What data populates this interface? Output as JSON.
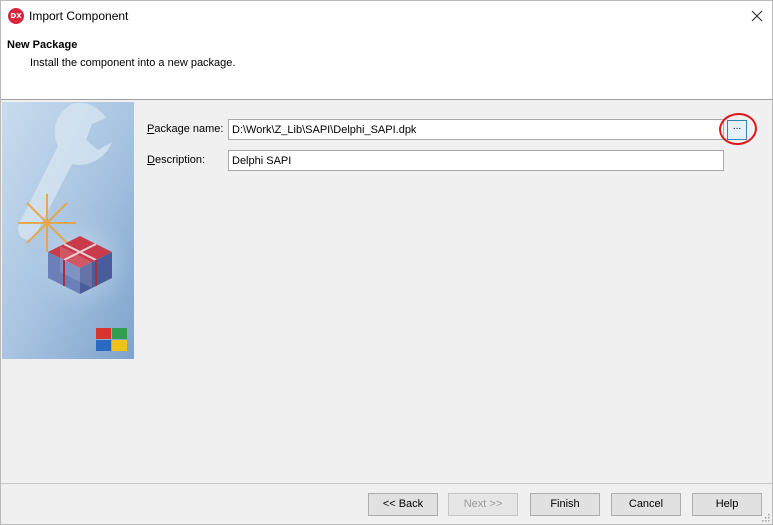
{
  "window": {
    "title": "Import Component",
    "app_icon_text": "DX"
  },
  "header": {
    "title": "New Package",
    "subtitle": "Install the component into a new package."
  },
  "form": {
    "package_name": {
      "label_mnemonic": "P",
      "label_rest": "ackage name:",
      "value": "D:\\Work\\Z_Lib\\SAPI\\Delphi_SAPI.dpk",
      "browse_label": "..."
    },
    "description": {
      "label_mnemonic": "D",
      "label_rest": "escription:",
      "value": "Delphi SAPI"
    }
  },
  "buttons": {
    "back": "<< Back",
    "next": "Next >>",
    "finish": "Finish",
    "cancel": "Cancel",
    "help": "Help"
  },
  "colors": {
    "annotation": "#e0161e",
    "side_image_blue": "#a8c4e0"
  }
}
